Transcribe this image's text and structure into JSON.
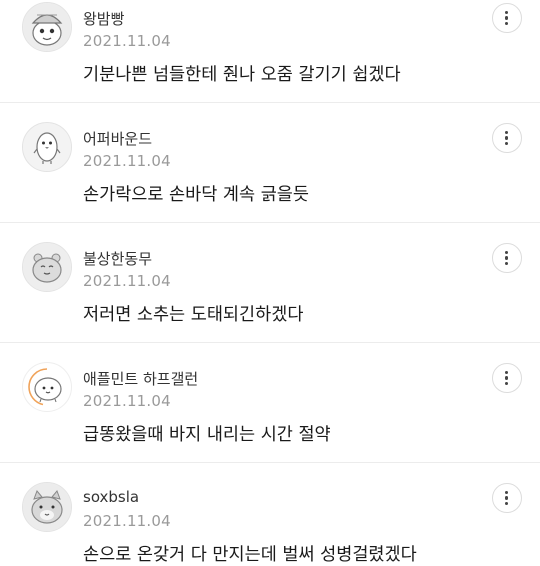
{
  "comments": [
    {
      "username": "왕밤빵",
      "date": "2021.11.04",
      "text": "기분나쁜 넘들한테 줜나 오줌 갈기기 쉽겠다",
      "avatar_icon": "character-avatar-icon"
    },
    {
      "username": "어퍼바운드",
      "date": "2021.11.04",
      "text": "손가락으로 손바닥 계속 긁을듯",
      "avatar_icon": "penguin-avatar-icon"
    },
    {
      "username": "불상한동무",
      "date": "2021.11.04",
      "text": "저러면 소추는 도태되긴하겠다",
      "avatar_icon": "hamster-avatar-icon"
    },
    {
      "username": "애플민트 하프갤런",
      "date": "2021.11.04",
      "text": "급똥왔을때 바지 내리는 시간 절약",
      "avatar_icon": "blob-avatar-icon"
    },
    {
      "username": "soxbsla",
      "date": "2021.11.04",
      "text": "손으로 온갖거 다 만지는데 벌써 성병걸렸겠다",
      "avatar_icon": "cat-avatar-icon"
    }
  ],
  "more_icon": "more-vertical-icon"
}
